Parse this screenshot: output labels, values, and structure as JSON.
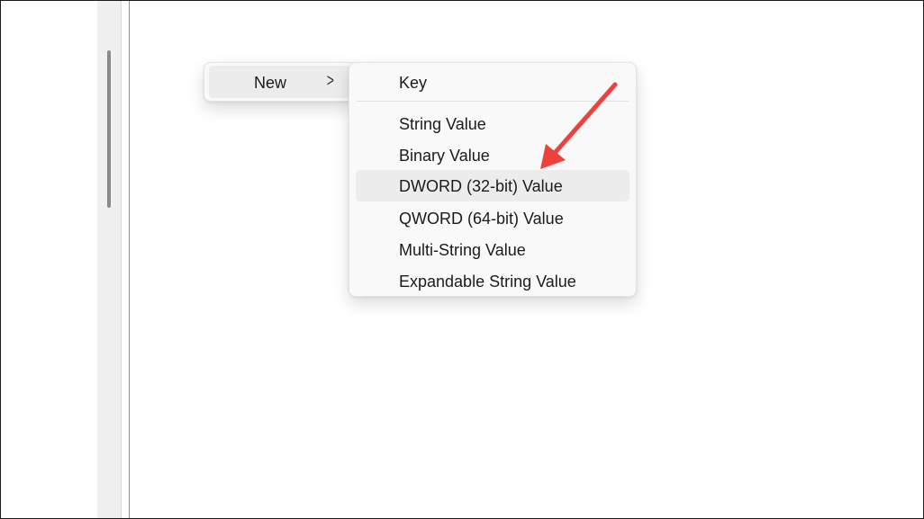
{
  "context_menu": {
    "parent_item_label": "New",
    "chevron_icon": "chevron-right-icon"
  },
  "submenu": {
    "key_label": "Key",
    "items": [
      {
        "label": "String Value"
      },
      {
        "label": "Binary Value"
      },
      {
        "label": "DWORD (32-bit) Value",
        "highlighted": true
      },
      {
        "label": "QWORD (64-bit) Value"
      },
      {
        "label": "Multi-String Value"
      },
      {
        "label": "Expandable String Value"
      }
    ]
  },
  "annotation": {
    "arrow_color": "#f0403c",
    "points_to": "DWORD (32-bit) Value"
  }
}
